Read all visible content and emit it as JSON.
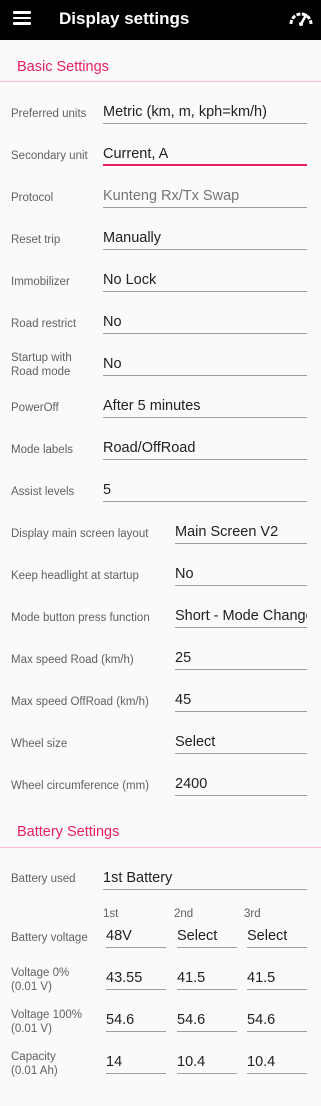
{
  "appbar": {
    "title": "Display settings",
    "menu_icon": "hamburger-menu-icon",
    "right_icon": "speedometer-icon"
  },
  "colors": {
    "accent": "#e91e63",
    "appbar_bg": "#000000",
    "rule": "#f8bbd0"
  },
  "basic": {
    "header": "Basic Settings",
    "rows": [
      {
        "label": "Preferred units",
        "value": "Metric (km, m, kph=km/h)"
      },
      {
        "label": "Secondary unit",
        "value": "Current, A"
      },
      {
        "label": "Protocol",
        "value": "Kunteng Rx/Tx Swap"
      },
      {
        "label": "Reset trip",
        "value": "Manually"
      },
      {
        "label": "Immobilizer",
        "value": "No Lock"
      },
      {
        "label": "Road restrict",
        "value": "No"
      },
      {
        "label": "Startup with\nRoad mode",
        "value": "No"
      },
      {
        "label": "PowerOff",
        "value": "After 5 minutes"
      },
      {
        "label": "Mode labels",
        "value": "Road/OffRoad"
      },
      {
        "label": "Assist levels",
        "value": "5"
      },
      {
        "label": "Display main screen layout",
        "value": "Main Screen V2"
      },
      {
        "label": "Keep headlight at startup",
        "value": "No"
      },
      {
        "label": "Mode button press function",
        "value": "Short - Mode Change"
      },
      {
        "label": "Max speed Road (km/h)",
        "value": "25"
      },
      {
        "label": "Max speed OffRoad (km/h)",
        "value": "45"
      },
      {
        "label": "Wheel size",
        "value": "Select"
      },
      {
        "label": "Wheel circumference (mm)",
        "value": "2400"
      }
    ]
  },
  "battery": {
    "header": "Battery Settings",
    "used_label": "Battery used",
    "used_value": "1st Battery",
    "columns": [
      "1st",
      "2nd",
      "3rd"
    ],
    "rows": [
      {
        "label": "Battery voltage",
        "values": [
          "48V",
          "Select",
          "Select"
        ]
      },
      {
        "label": "Voltage 0%\n(0.01 V)",
        "values": [
          "43.55",
          "41.5",
          "41.5"
        ]
      },
      {
        "label": "Voltage 100%\n(0.01 V)",
        "values": [
          "54.6",
          "54.6",
          "54.6"
        ]
      },
      {
        "label": "Capacity\n(0.01 Ah)",
        "values": [
          "14",
          "10.4",
          "10.4"
        ]
      }
    ]
  }
}
